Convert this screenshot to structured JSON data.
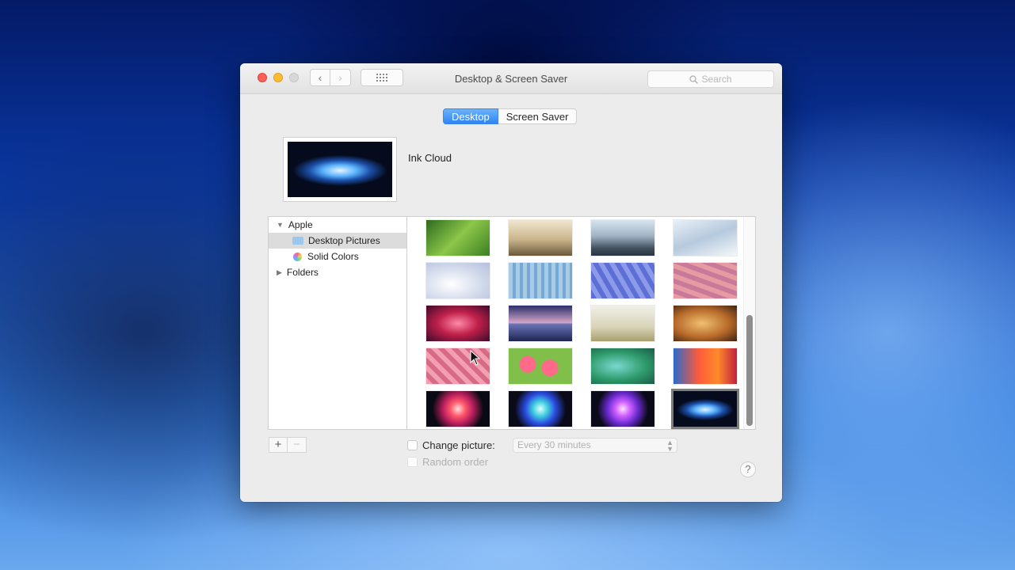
{
  "window": {
    "title": "Desktop & Screen Saver",
    "search_placeholder": "Search",
    "nav": {
      "back_icon": "chevron-left-icon",
      "forward_icon": "chevron-right-icon",
      "grid_icon": "grid-icon"
    }
  },
  "tabs": [
    {
      "label": "Desktop",
      "active": true
    },
    {
      "label": "Screen Saver",
      "active": false
    }
  ],
  "current_wallpaper": {
    "name": "Ink Cloud"
  },
  "sidebar": {
    "groups": [
      {
        "label": "Apple",
        "expanded": true,
        "children": [
          {
            "label": "Desktop Pictures",
            "icon": "folder-icon",
            "selected": true
          },
          {
            "label": "Solid Colors",
            "icon": "color-wheel-icon",
            "selected": false
          }
        ]
      },
      {
        "label": "Folders",
        "expanded": false
      }
    ]
  },
  "thumbnails": {
    "selected_index": 19,
    "count": 20
  },
  "bottom_bar": {
    "add_label": "+",
    "remove_label": "−",
    "change_picture_label": "Change picture:",
    "change_picture_checked": false,
    "interval": "Every 30 minutes",
    "random_order_label": "Random order",
    "random_order_checked": false,
    "help_label": "?"
  },
  "colors": {
    "accent": "#2c85f5",
    "close": "#fc5f57",
    "minimize": "#fdbc2e"
  }
}
